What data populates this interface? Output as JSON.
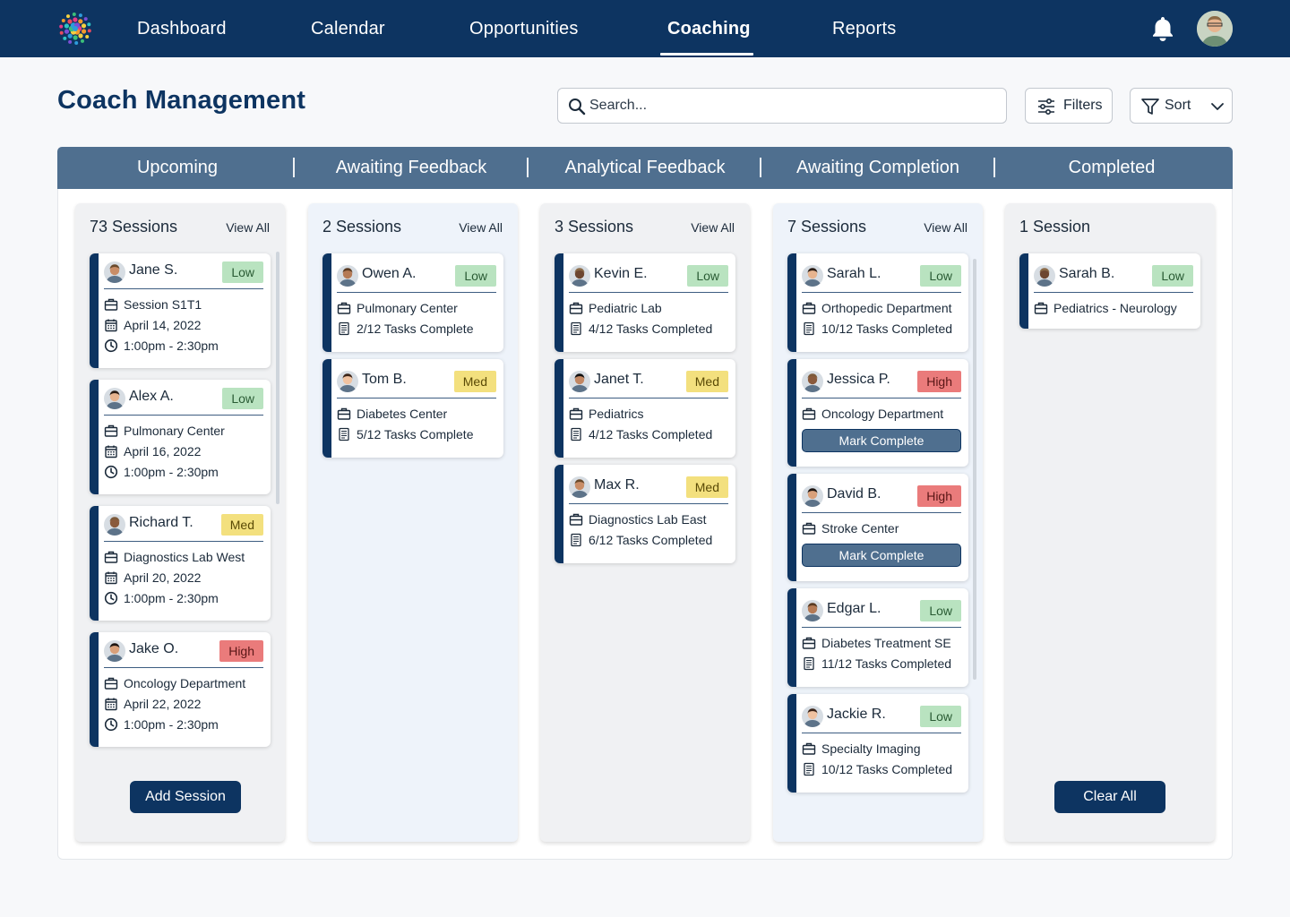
{
  "nav": {
    "items": [
      "Dashboard",
      "Calendar",
      "Opportunities",
      "Coaching",
      "Reports"
    ],
    "active": "Coaching"
  },
  "header": {
    "title": "Coach Management",
    "search_placeholder": "Search...",
    "filters_label": "Filters",
    "sort_label": "Sort"
  },
  "stages": [
    "Upcoming",
    "Awaiting Feedback",
    "Analytical Feedback",
    "Awaiting Completion",
    "Completed"
  ],
  "columns": [
    {
      "count_label": "73 Sessions",
      "view_all": "View All",
      "cards": [
        {
          "name": "Jane S.",
          "priority": "Low",
          "lines": [
            "Session S1T1",
            "April 14, 2022",
            "1:00pm - 2:30pm"
          ]
        },
        {
          "name": "Alex A.",
          "priority": "Low",
          "lines": [
            "Pulmonary Center",
            "April 16, 2022",
            "1:00pm - 2:30pm"
          ]
        },
        {
          "name": "Richard T.",
          "priority": "Med",
          "lines": [
            "Diagnostics Lab West",
            "April 20, 2022",
            "1:00pm - 2:30pm"
          ]
        },
        {
          "name": "Jake O.",
          "priority": "High",
          "lines": [
            "Oncology Department",
            "April 22, 2022",
            "1:00pm - 2:30pm"
          ]
        }
      ],
      "action": "Add Session"
    },
    {
      "count_label": "2 Sessions",
      "view_all": "View All",
      "cards": [
        {
          "name": "Owen A.",
          "priority": "Low",
          "lines": [
            "Pulmonary Center",
            "2/12 Tasks Complete"
          ]
        },
        {
          "name": "Tom B.",
          "priority": "Med",
          "lines": [
            "Diabetes Center",
            "5/12 Tasks Complete"
          ]
        }
      ]
    },
    {
      "count_label": "3 Sessions",
      "view_all": "View All",
      "cards": [
        {
          "name": "Kevin E.",
          "priority": "Low",
          "lines": [
            "Pediatric Lab",
            "4/12 Tasks Completed"
          ]
        },
        {
          "name": "Janet T.",
          "priority": "Med",
          "lines": [
            "Pediatrics",
            "4/12 Tasks Completed"
          ]
        },
        {
          "name": "Max R.",
          "priority": "Med",
          "lines": [
            "Diagnostics Lab East",
            "6/12 Tasks Completed"
          ]
        }
      ]
    },
    {
      "count_label": "7 Sessions",
      "view_all": "View All",
      "cards": [
        {
          "name": "Sarah L.",
          "priority": "Low",
          "lines": [
            "Orthopedic Department",
            "10/12 Tasks Completed"
          ]
        },
        {
          "name": "Jessica P.",
          "priority": "High",
          "lines": [
            "Oncology Department"
          ],
          "button": "Mark Complete"
        },
        {
          "name": "David B.",
          "priority": "High",
          "lines": [
            "Stroke Center"
          ],
          "button": "Mark Complete"
        },
        {
          "name": "Edgar L.",
          "priority": "Low",
          "lines": [
            "Diabetes Treatment SE",
            "11/12 Tasks Completed"
          ]
        },
        {
          "name": "Jackie R.",
          "priority": "Low",
          "lines": [
            "Specialty Imaging",
            "10/12 Tasks Completed"
          ]
        }
      ]
    },
    {
      "count_label": "1 Session",
      "cards": [
        {
          "name": "Sarah B.",
          "priority": "Low",
          "lines": [
            "Pediatrics - Neurology"
          ]
        }
      ],
      "action": "Clear All"
    }
  ],
  "colors": {
    "navy": "#0d3461",
    "stage_bar": "#4f6f8f",
    "low": "#b9e3c0",
    "med": "#f3e07e",
    "high": "#ea7b7b"
  },
  "icons": [
    "bell-icon",
    "search-icon",
    "filters-icon",
    "funnel-icon",
    "chevron-down-icon",
    "briefcase-icon",
    "calendar-icon",
    "clock-icon",
    "checklist-icon"
  ]
}
